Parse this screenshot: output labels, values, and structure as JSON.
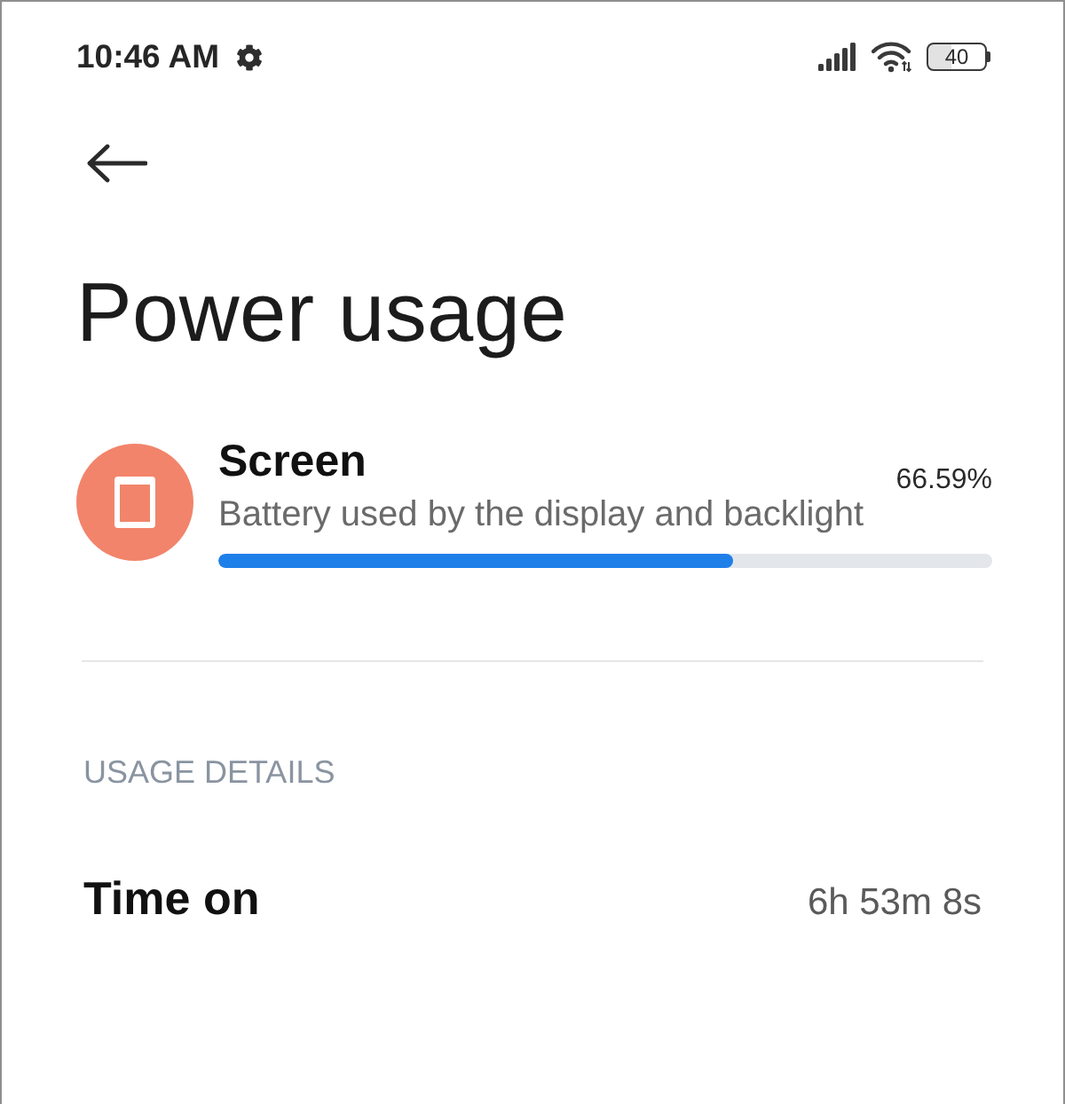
{
  "status_bar": {
    "time": "10:46 AM",
    "battery": "40"
  },
  "title": "Power usage",
  "usage_item": {
    "name": "Screen",
    "description": "Battery used by the display and backlight",
    "percent": "66.59%",
    "level": 0.6659
  },
  "section_header": "USAGE DETAILS",
  "details": [
    {
      "label": "Time on",
      "value": "6h 53m 8s"
    }
  ]
}
